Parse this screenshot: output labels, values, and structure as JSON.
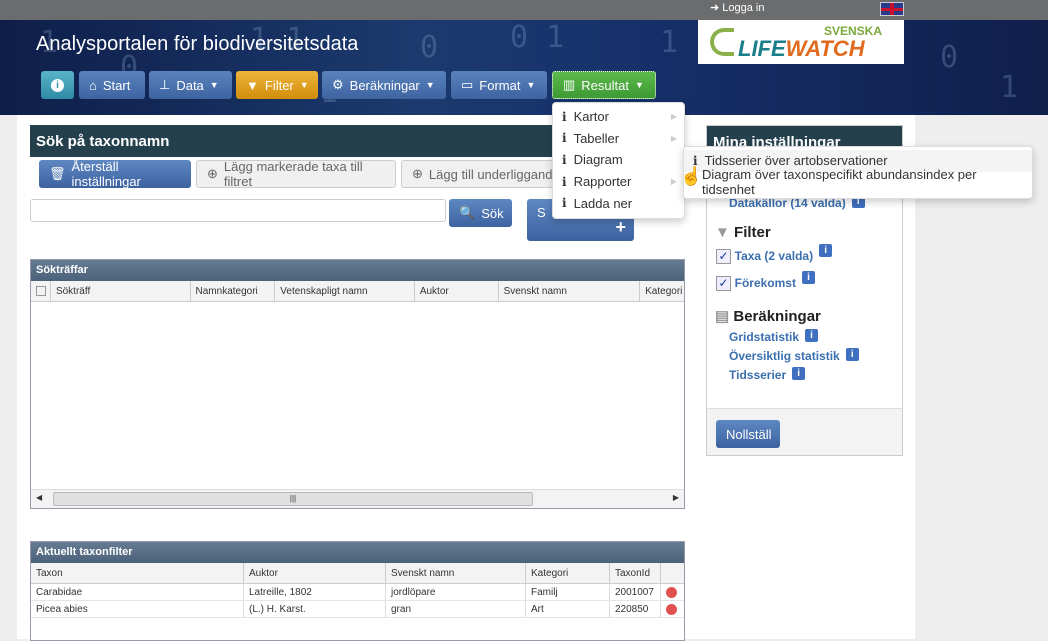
{
  "topbar": {
    "login": "Logga in",
    "language_flag": "uk-flag"
  },
  "header": {
    "title": "Analysportalen för biodiversitetsdata",
    "logo_top": "SVENSKA",
    "logo_main_a": "LIFE",
    "logo_main_b": "WATCH"
  },
  "nav": {
    "info": "i",
    "start": "Start",
    "data": "Data",
    "filter": "Filter",
    "berakningar": "Beräkningar",
    "format": "Format",
    "resultat": "Resultat"
  },
  "colors": {
    "nav_blue": "#4a70ad",
    "filter_orange": "#e0a020",
    "resultat_green": "#4caa3e",
    "panel_dark": "#25404d"
  },
  "search": {
    "title": "Sök på taxonnamn",
    "reset": "Återställ inställningar",
    "add_marked": "Lägg markerade taxa till filtret",
    "add_underlying": "Lägg till underliggande",
    "input_value": "",
    "search_button": "Sök",
    "big_button": "S",
    "big_button_icon": "+"
  },
  "results": {
    "title": "Sökträffar",
    "columns": [
      "Sökträff",
      "Namnkategori",
      "Vetenskapligt namn",
      "Auktor",
      "Svenskt namn",
      "Kategori"
    ]
  },
  "taxonfilter": {
    "title": "Aktuellt taxonfilter",
    "columns": [
      "Taxon",
      "Auktor",
      "Svenskt namn",
      "Kategori",
      "TaxonId"
    ],
    "rows": [
      [
        "Carabidae",
        "Latreille, 1802",
        "jordlöpare",
        "Familj",
        "2001007"
      ],
      [
        "Picea abies",
        "(L.) H. Karst.",
        "gran",
        "Art",
        "220850"
      ]
    ]
  },
  "settings": {
    "title": "Mina inställningar",
    "datasources": "Datakällor (14 valda)",
    "filter_title": "Filter",
    "taxa": "Taxa (2 valda)",
    "occurrence": "Förekomst",
    "calc_title": "Beräkningar",
    "grid": "Gridstatistik",
    "overview": "Översiktlig statistik",
    "timeseries": "Tidsserier",
    "reset": "Nollställ"
  },
  "menu": {
    "items": [
      "Kartor",
      "Tabeller",
      "Diagram",
      "Rapporter",
      "Ladda ner"
    ]
  },
  "submenu": {
    "items": [
      "Tidsserier över artobservationer",
      "Diagram över taxonspecifikt abundansindex per tidsenhet"
    ]
  }
}
